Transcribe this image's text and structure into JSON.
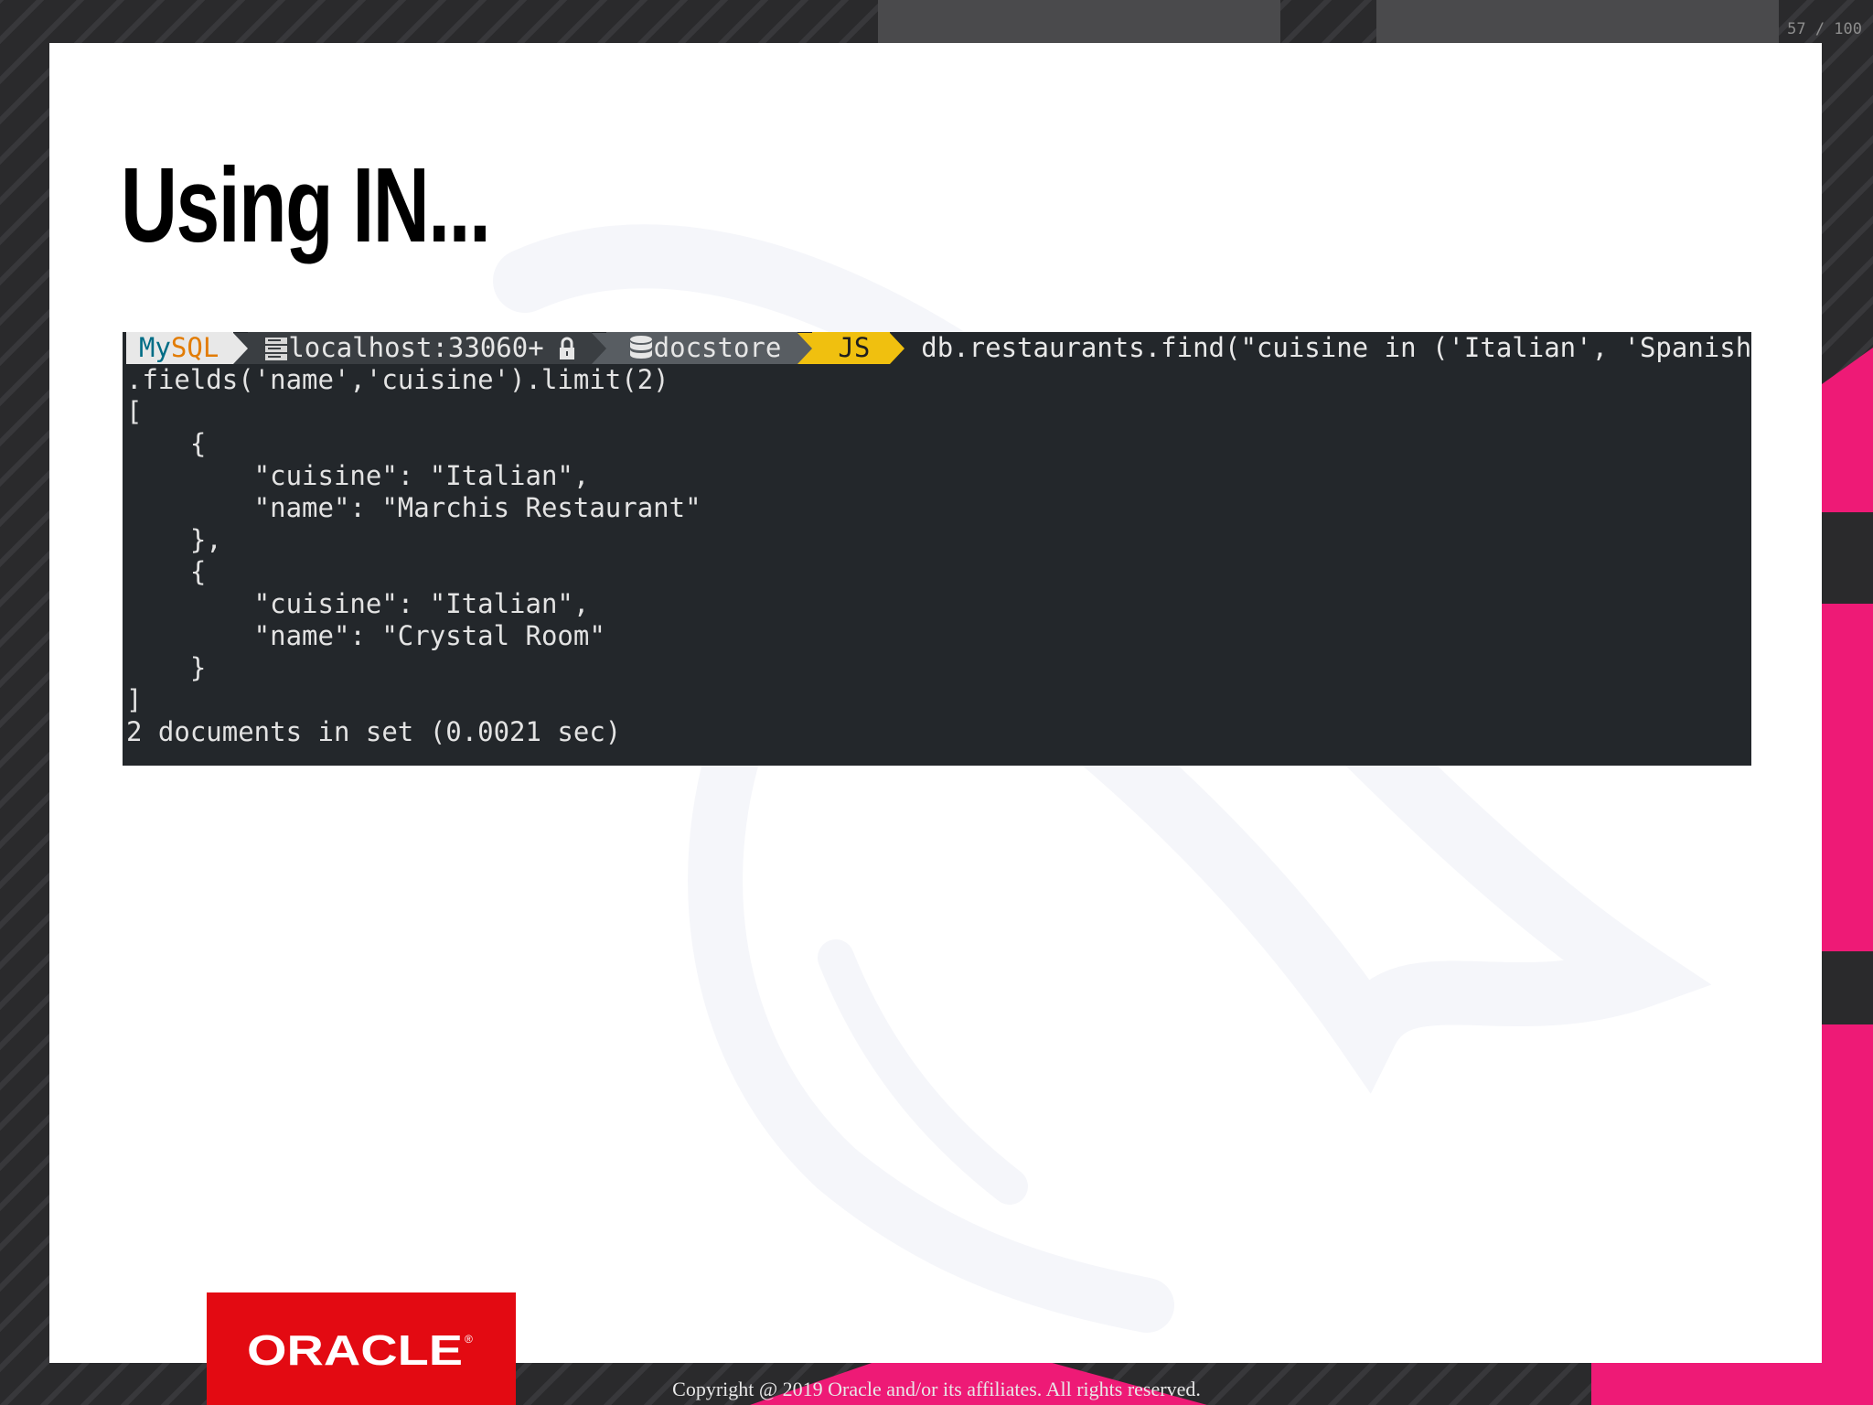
{
  "page_counter": "57 / 100",
  "slide": {
    "title": "Using IN..."
  },
  "terminal": {
    "prompt": {
      "brand_my": "My",
      "brand_sql": "SQL",
      "host": "localhost:33060+",
      "schema": "docstore",
      "mode": "JS",
      "command": "db.restaurants.find(\"cuisine in ('Italian', 'Spanish')\")"
    },
    "lines": [
      ".fields('name','cuisine').limit(2)",
      "[",
      "    {",
      "        \"cuisine\": \"Italian\",",
      "        \"name\": \"Marchis Restaurant\"",
      "    },",
      "    {",
      "        \"cuisine\": \"Italian\",",
      "        \"name\": \"Crystal Room\"",
      "    }",
      "]",
      "2 documents in set (0.0021 sec)"
    ],
    "icons": {
      "host": "server-icon",
      "lock": "lock-icon",
      "schema": "database-icon"
    }
  },
  "footer": {
    "logo_text": "ORACLE",
    "copyright": "Copyright @ 2019 Oracle and/or its affiliates. All rights reserved."
  },
  "colors": {
    "terminal_bg": "#23272b",
    "mode_segment": "#f0c00f",
    "oracle_red": "#e30a12",
    "accent_pink": "#ee1a76"
  }
}
